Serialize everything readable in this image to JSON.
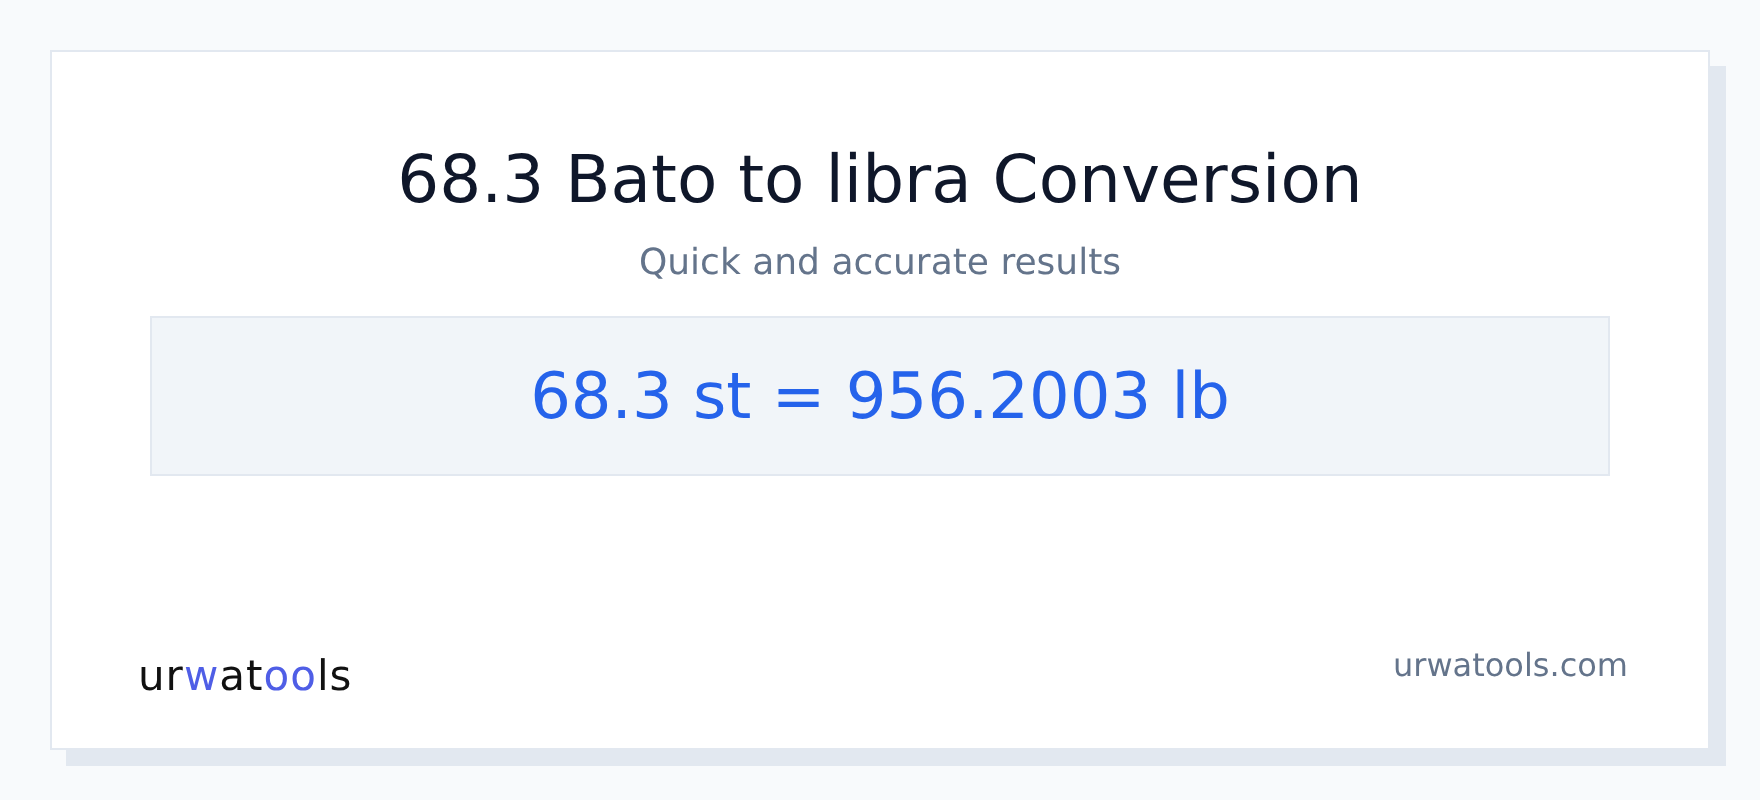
{
  "title": "68.3 Bato to libra Conversion",
  "subtitle": "Quick and accurate results",
  "result": "68.3 st = 956.2003 lb",
  "logo": [
    {
      "text": "ur",
      "accent": false
    },
    {
      "text": "w",
      "accent": true
    },
    {
      "text": "at",
      "accent": false
    },
    {
      "text": "oo",
      "accent": true
    },
    {
      "text": "ls",
      "accent": false
    }
  ],
  "site": "urwatools.com"
}
